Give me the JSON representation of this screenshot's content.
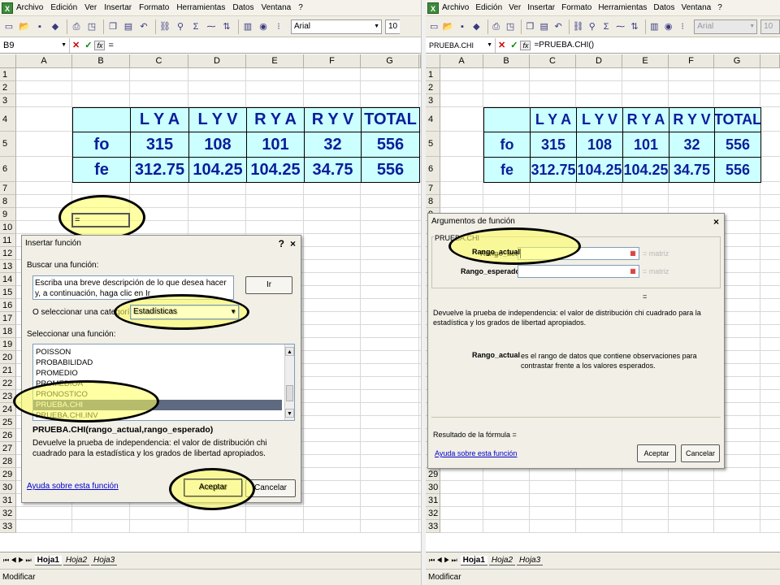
{
  "menu": [
    "Archivo",
    "Edición",
    "Ver",
    "Insertar",
    "Formato",
    "Herramientas",
    "Datos",
    "Ventana",
    "?"
  ],
  "toolbar": {
    "font_left": "Arial",
    "size_left": "10",
    "font_right": "Arial",
    "size_right": "10",
    "sigma": "Σ"
  },
  "left_formula": {
    "namebox": "B9",
    "content": "="
  },
  "right_formula": {
    "namebox": "PRUEBA.CHI",
    "content": "=PRUEBA.CHI()"
  },
  "fx_label": "fx",
  "columns": [
    "A",
    "B",
    "C",
    "D",
    "E",
    "F",
    "G"
  ],
  "rows": [
    "1",
    "2",
    "3",
    "4",
    "5",
    "6",
    "7",
    "8",
    "9",
    "10",
    "11",
    "12",
    "13",
    "14",
    "15",
    "16",
    "17",
    "18",
    "19",
    "20",
    "21",
    "22",
    "23",
    "24",
    "25",
    "26",
    "27",
    "28",
    "29",
    "30",
    "31",
    "32",
    "33"
  ],
  "table": {
    "header": [
      "",
      "L Y A",
      "L Y V",
      "R Y A",
      "R Y V",
      "TOTAL"
    ],
    "rows": [
      [
        "fo",
        "315",
        "108",
        "101",
        "32",
        "556"
      ],
      [
        "fe",
        "312.75",
        "104.25",
        "104.25",
        "34.75",
        "556"
      ]
    ]
  },
  "active_cell_value": "=",
  "insert_dialog": {
    "title": "Insertar función",
    "help_q": "?",
    "close": "×",
    "search_label": "Buscar una función:",
    "search_text": "Escriba una breve descripción de lo que desea hacer y, a continuación, haga clic en Ir",
    "go_button": "Ir",
    "category_label": "O seleccionar una categoría:",
    "category_value": "Estadísticas",
    "select_label": "Seleccionar una función:",
    "functions": [
      "POISSON",
      "PROBABILIDAD",
      "PROMEDIO",
      "PROMEDIOA",
      "PRONOSTICO",
      "PRUEBA.CHI",
      "PRUEBA.CHI.INV"
    ],
    "selected_index": 5,
    "signature": "PRUEBA.CHI(rango_actual,rango_esperado)",
    "description": "Devuelve la prueba de independencia: el valor de distribución chi cuadrado para la estadística y los grados de libertad apropiados.",
    "help_link": "Ayuda sobre esta función",
    "ok": "Aceptar",
    "cancel": "Cancelar"
  },
  "args_dialog": {
    "title": "Argumentos de función",
    "close": "×",
    "group": "PRUEBA.CHI",
    "arg1_label": "Rango_actual",
    "arg2_label": "Rango_esperado",
    "arg_result": "= matriz",
    "equals": "=",
    "description": "Devuelve la prueba de independencia: el valor de distribución chi cuadrado para la estadística y los grados de libertad apropiados.",
    "arg_help_label": "Rango_actual",
    "arg_help_text": "es el rango de datos que contiene observaciones para contrastar frente a los valores esperados.",
    "result_label": "Resultado de la fórmula =",
    "help_link": "Ayuda sobre esta función",
    "ok": "Aceptar",
    "cancel": "Cancelar"
  },
  "sheets": [
    "Hoja1",
    "Hoja2",
    "Hoja3"
  ],
  "status": "Modificar"
}
